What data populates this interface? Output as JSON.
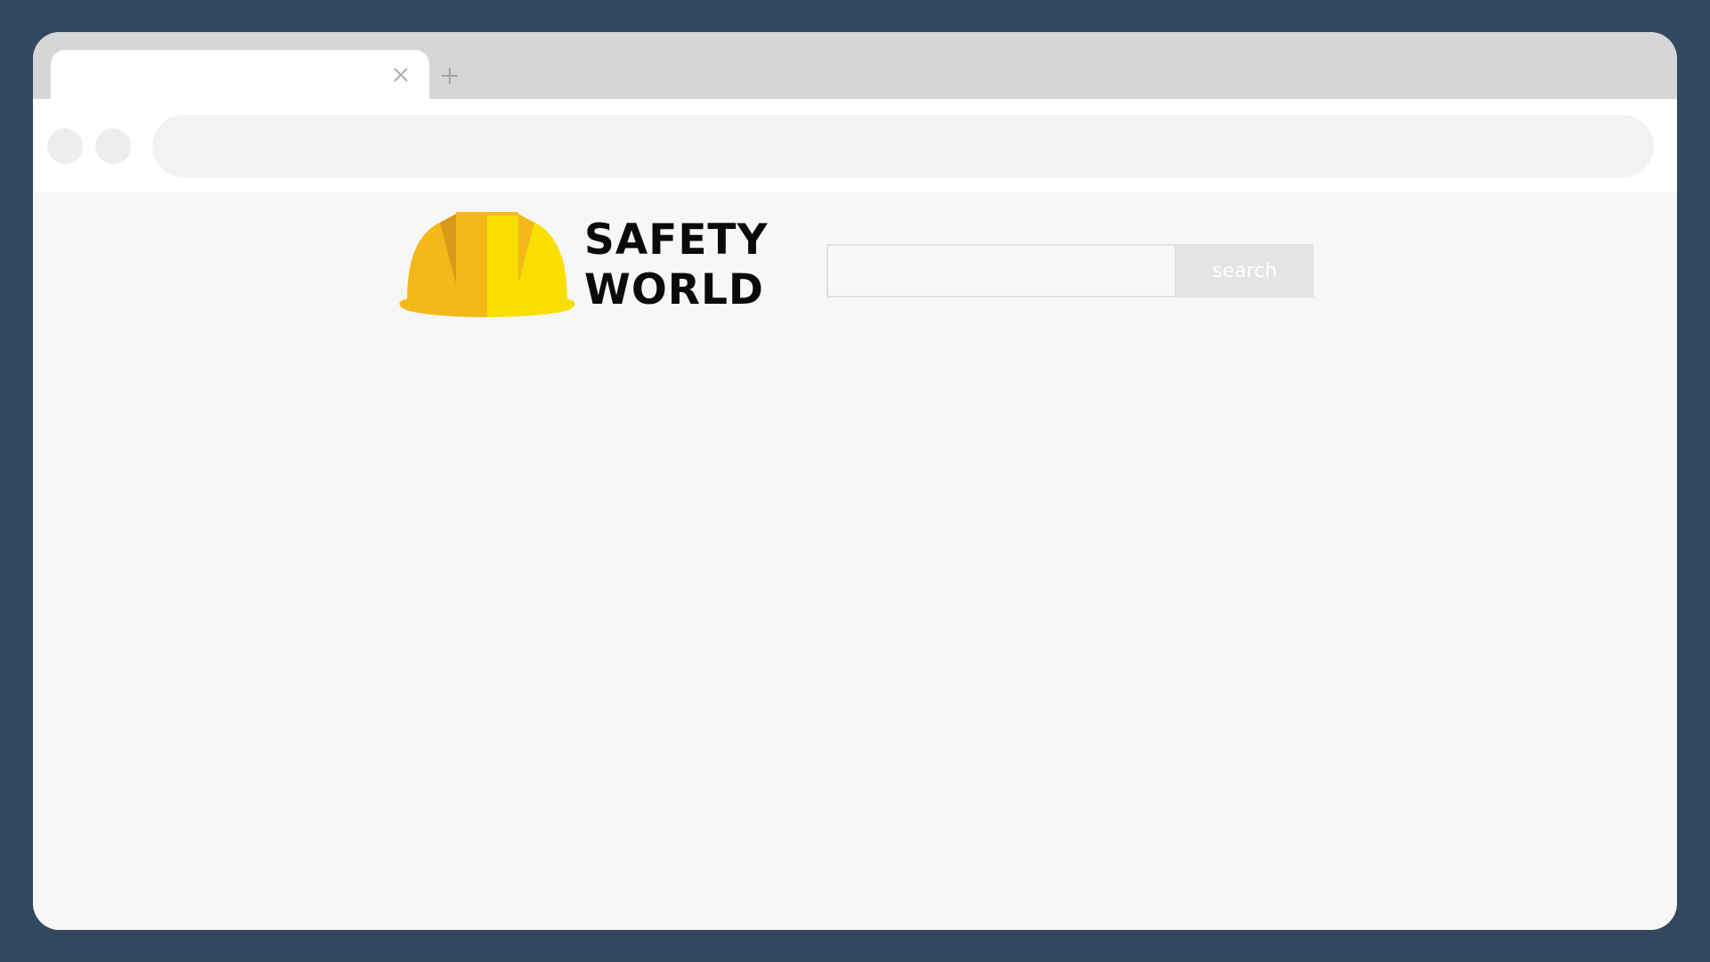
{
  "browser": {
    "tab": {
      "title": "",
      "close_icon": "close-icon"
    },
    "new_tab_icon": "plus-icon",
    "nav": {
      "back_icon": "circle-button",
      "forward_icon": "circle-button"
    },
    "address_bar": {
      "value": ""
    }
  },
  "site": {
    "logo": {
      "icon": "hard-hat-icon",
      "line1": "SAFETY",
      "line2": "WORLD"
    },
    "search": {
      "input_value": "",
      "button_label": "search"
    }
  },
  "colors": {
    "outer_frame": "#33485e",
    "tab_strip": "#d5d6d8",
    "page_background": "#f7f7f7",
    "helmet_primary": "#f4b81a",
    "helmet_secondary": "#f8df00",
    "search_button": "#e4e4e4"
  }
}
